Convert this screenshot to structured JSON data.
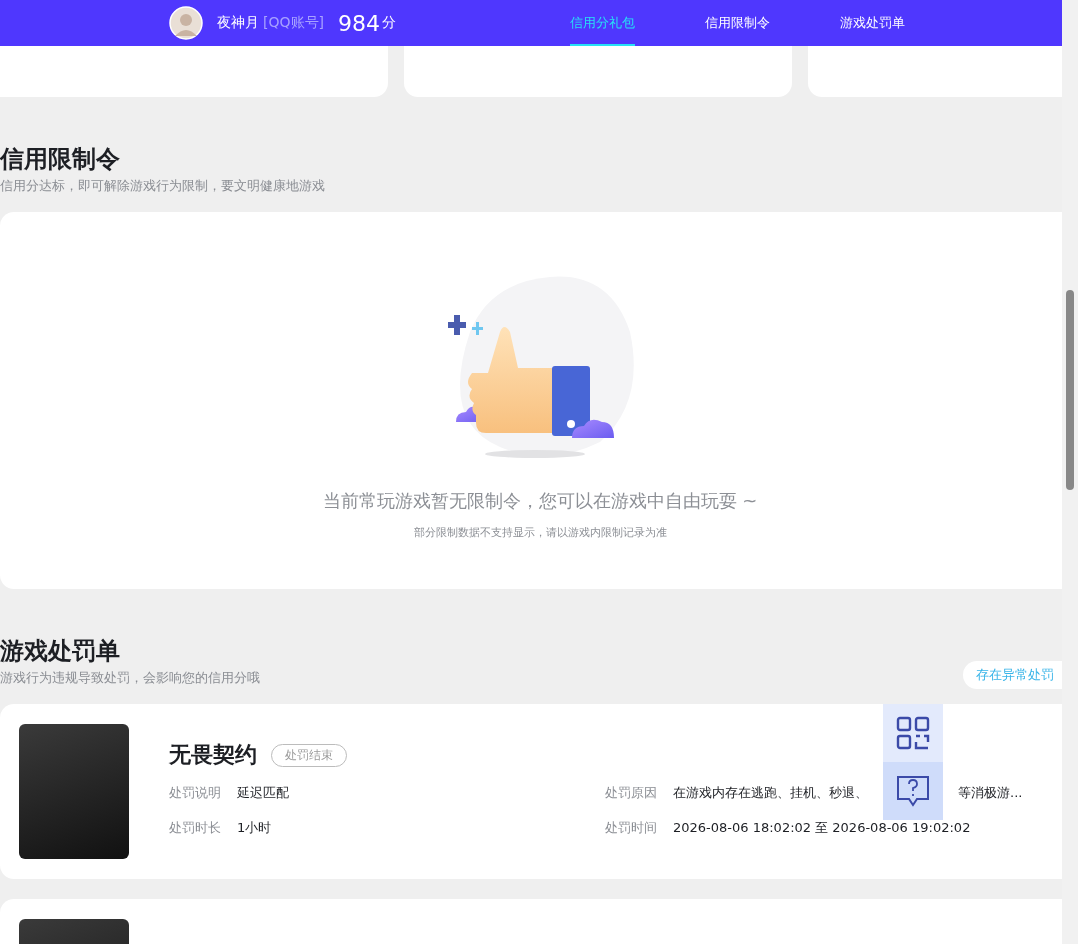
{
  "header": {
    "user": {
      "name": "夜神月",
      "account_type": "[QQ账号]",
      "score": "984",
      "score_unit": "分"
    },
    "tabs": [
      {
        "label": "信用分礼包",
        "selected": true
      },
      {
        "label": "信用限制令",
        "selected": false
      },
      {
        "label": "游戏处罚单",
        "selected": false
      }
    ]
  },
  "restriction_section": {
    "title": "信用限制令",
    "subtitle": "信用分达标，即可解除游戏行为限制，要文明健康地游戏",
    "empty_state": {
      "message": "当前常玩游戏暂无限制令，您可以在游戏中自由玩耍 ~",
      "note": "部分限制数据不支持显示，请以游戏内限制记录为准"
    }
  },
  "penalty_section": {
    "title": "游戏处罚单",
    "subtitle": "游戏行为违规导致处罚，会影响您的信用分哦",
    "action": "存在异常处罚",
    "records": [
      {
        "kind": "full",
        "game": "无畏契约",
        "status": "处罚结束",
        "fields": [
          {
            "label": "处罚说明",
            "value_segments": [
              "延迟匹配"
            ]
          },
          {
            "label": "处罚原因",
            "value_segments": [
              "在游戏内存在逃跑、挂机、秒退、",
              "等消极游..."
            ]
          },
          {
            "label": "处罚时长",
            "value_segments": [
              "1小时"
            ]
          },
          {
            "label": "处罚时间",
            "value_segments": [
              "2026-08-06 18:02:02 至 2026-08-06 19:02:02"
            ]
          }
        ]
      },
      {
        "kind": "partial"
      }
    ]
  }
}
